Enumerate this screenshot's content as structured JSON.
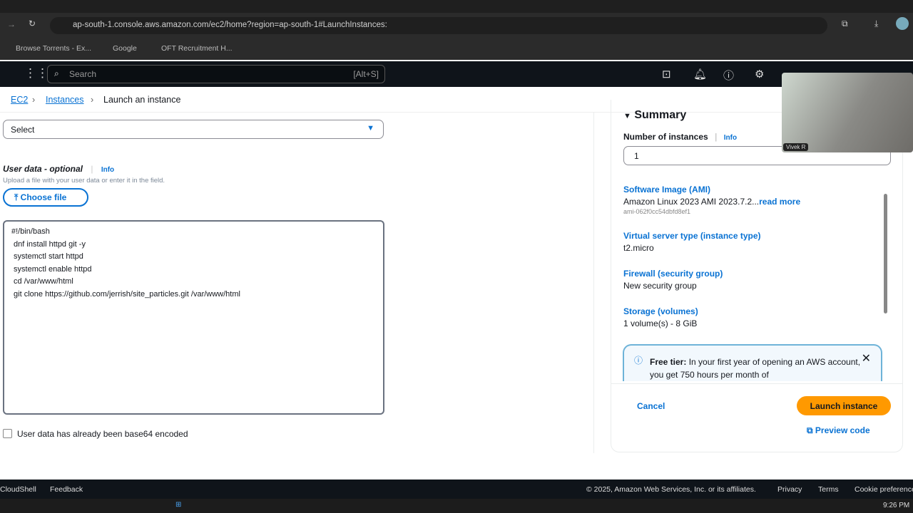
{
  "browser": {
    "url": "ap-south-1.console.aws.amazon.com/ec2/home?region=ap-south-1#LaunchInstances:",
    "bookmarks": [
      "Browse Torrents - Ex...",
      "Google",
      "OFT Recruitment H..."
    ]
  },
  "aws_nav": {
    "search_placeholder": "Search",
    "search_shortcut": "[Alt+S]"
  },
  "breadcrumb": [
    "EC2",
    "Instances",
    "Launch an instance"
  ],
  "form": {
    "select_value": "Select",
    "user_data_label": "User data - optional",
    "info": "Info",
    "user_data_desc": "Upload a file with your user data or enter it in the field.",
    "choose_file": "Choose file",
    "user_data_value": "#!/bin/bash\n dnf install httpd git -y\n systemctl start httpd\n systemctl enable httpd\n cd /var/www/html\n git clone https://github.com/jerrish/site_particles.git /var/www/html",
    "base64_label": "User data has already been base64 encoded"
  },
  "summary": {
    "title": "Summary",
    "num_label": "Number of instances",
    "info": "Info",
    "num_value": "1",
    "ami_label": "Software Image (AMI)",
    "ami_value": "Amazon Linux 2023 AMI 2023.7.2...",
    "read_more": "read more",
    "ami_id": "ami-062f0cc54dbfd8ef1",
    "type_label": "Virtual server type (instance type)",
    "type_value": "t2.micro",
    "fw_label": "Firewall (security group)",
    "fw_value": "New security group",
    "storage_label": "Storage (volumes)",
    "storage_value": "1 volume(s) - 8 GiB",
    "free_tier_bold": "Free tier:",
    "free_tier_text": " In your first year of opening an AWS account, you get 750 hours per month of",
    "cancel": "Cancel",
    "launch": "Launch instance",
    "preview": "Preview code"
  },
  "camera": {
    "name": "Vivek R"
  },
  "footer": {
    "cloudshell": "CloudShell",
    "feedback": "Feedback",
    "copyright": "© 2025, Amazon Web Services, Inc. or its affiliates.",
    "privacy": "Privacy",
    "terms": "Terms",
    "cookie": "Cookie preferences"
  },
  "taskbar": {
    "time": "9:26 PM"
  }
}
